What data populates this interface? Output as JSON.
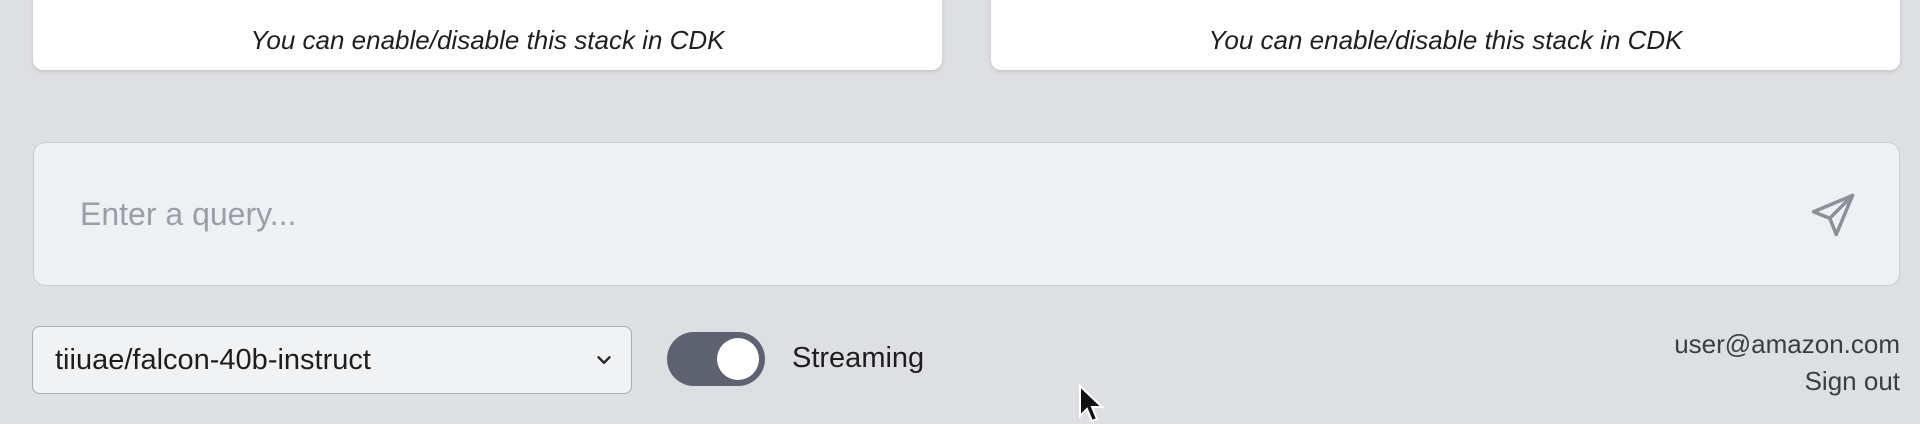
{
  "cards": [
    {
      "text": "You can enable/disable this stack in CDK"
    },
    {
      "text": "You can enable/disable this stack in CDK"
    }
  ],
  "query": {
    "placeholder": "Enter a query...",
    "value": ""
  },
  "model_select": {
    "selected": "tiiuae/falcon-40b-instruct"
  },
  "streaming": {
    "label": "Streaming",
    "enabled": true
  },
  "user": {
    "email": "user@amazon.com",
    "sign_out_label": "Sign out"
  },
  "icons": {
    "send": "send-icon",
    "chevron": "chevron-down-icon",
    "cursor": "mouse-cursor-icon"
  },
  "colors": {
    "background": "#dedfe3",
    "toggle_on": "#5d6170",
    "placeholder": "#9a9ea6"
  }
}
